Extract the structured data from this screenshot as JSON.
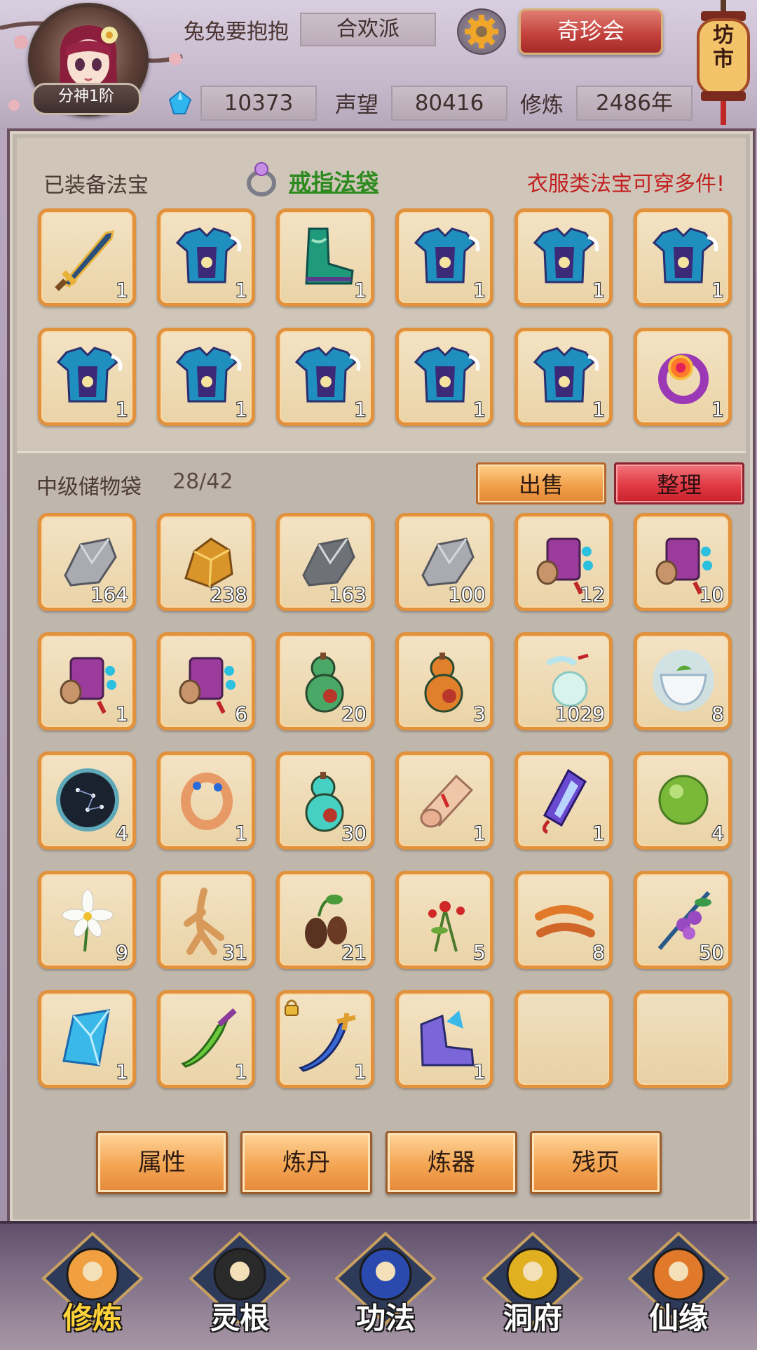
{
  "header": {
    "rank_badge": "分神1阶",
    "player_name": "兔兔要抱抱",
    "sect": "合欢派",
    "treasure_button": "奇珍会",
    "market_sign": "坊市",
    "spirit_stones": "10373",
    "prestige_label": "声望",
    "prestige_value": "80416",
    "cultivation_label": "修炼",
    "cultivation_value": "2486年"
  },
  "equipped": {
    "title": "已装备法宝",
    "ring_bag_link": "戒指法袋",
    "notice": "衣服类法宝可穿多件!",
    "slots": [
      {
        "icon": "sword-icon",
        "count": "1"
      },
      {
        "icon": "robe-armor-icon",
        "count": "1"
      },
      {
        "icon": "boots-icon",
        "count": "1"
      },
      {
        "icon": "robe-armor-icon",
        "count": "1"
      },
      {
        "icon": "robe-armor-icon",
        "count": "1"
      },
      {
        "icon": "robe-armor-icon",
        "count": "1"
      },
      {
        "icon": "robe-armor-icon",
        "count": "1"
      },
      {
        "icon": "robe-armor-icon",
        "count": "1"
      },
      {
        "icon": "robe-armor-icon",
        "count": "1"
      },
      {
        "icon": "robe-armor-icon",
        "count": "1"
      },
      {
        "icon": "robe-armor-icon",
        "count": "1"
      },
      {
        "icon": "jewel-ring-icon",
        "count": "1"
      }
    ]
  },
  "bag": {
    "title": "中级储物袋",
    "capacity": "28/42",
    "sell_button": "出售",
    "sort_button": "整理",
    "slots": [
      {
        "icon": "silver-ore-icon",
        "count": "164"
      },
      {
        "icon": "gold-ore-icon",
        "count": "238"
      },
      {
        "icon": "iron-ore-icon",
        "count": "163"
      },
      {
        "icon": "stone-ore-icon",
        "count": "100"
      },
      {
        "icon": "scroll-icon",
        "count": "12"
      },
      {
        "icon": "scroll-icon",
        "count": "10"
      },
      {
        "icon": "scroll-icon",
        "count": "1"
      },
      {
        "icon": "scroll-icon",
        "count": "6"
      },
      {
        "icon": "green-gourd-icon",
        "count": "20"
      },
      {
        "icon": "orange-gourd-icon",
        "count": "3"
      },
      {
        "icon": "spirit-orb-icon",
        "count": "1029"
      },
      {
        "icon": "tea-bowl-icon",
        "count": "8"
      },
      {
        "icon": "star-map-icon",
        "count": "4"
      },
      {
        "icon": "bracelet-icon",
        "count": "1"
      },
      {
        "icon": "jade-gourd-icon",
        "count": "30"
      },
      {
        "icon": "paper-scroll-icon",
        "count": "1"
      },
      {
        "icon": "talisman-icon",
        "count": "1"
      },
      {
        "icon": "green-pearl-icon",
        "count": "4"
      },
      {
        "icon": "white-flower-icon",
        "count": "9"
      },
      {
        "icon": "ginseng-icon",
        "count": "31"
      },
      {
        "icon": "herb-root-icon",
        "count": "21"
      },
      {
        "icon": "red-herb-icon",
        "count": "5"
      },
      {
        "icon": "cordyceps-icon",
        "count": "8"
      },
      {
        "icon": "berry-branch-icon",
        "count": "50"
      },
      {
        "icon": "blue-crystal-icon",
        "count": "1"
      },
      {
        "icon": "green-blade-icon",
        "count": "1"
      },
      {
        "icon": "curved-sword-icon",
        "count": "1",
        "locked": true
      },
      {
        "icon": "purple-boots-icon",
        "count": "1"
      },
      {
        "icon": "",
        "count": ""
      },
      {
        "icon": "",
        "count": ""
      }
    ]
  },
  "actions": [
    "属性",
    "炼丹",
    "炼器",
    "残页"
  ],
  "nav": [
    {
      "label": "修炼",
      "icon": "cultivation-icon",
      "active": true
    },
    {
      "label": "灵根",
      "icon": "spirit-root-icon",
      "active": false
    },
    {
      "label": "功法",
      "icon": "technique-book-icon",
      "active": false
    },
    {
      "label": "洞府",
      "icon": "cave-mansion-icon",
      "active": false
    },
    {
      "label": "仙缘",
      "icon": "fortune-gourd-icon",
      "active": false
    }
  ],
  "colors": {
    "slot_border": "#e2913d",
    "notice_red": "#c22020",
    "link_green": "#2c8a1f",
    "active_nav": "#ffd23a"
  }
}
